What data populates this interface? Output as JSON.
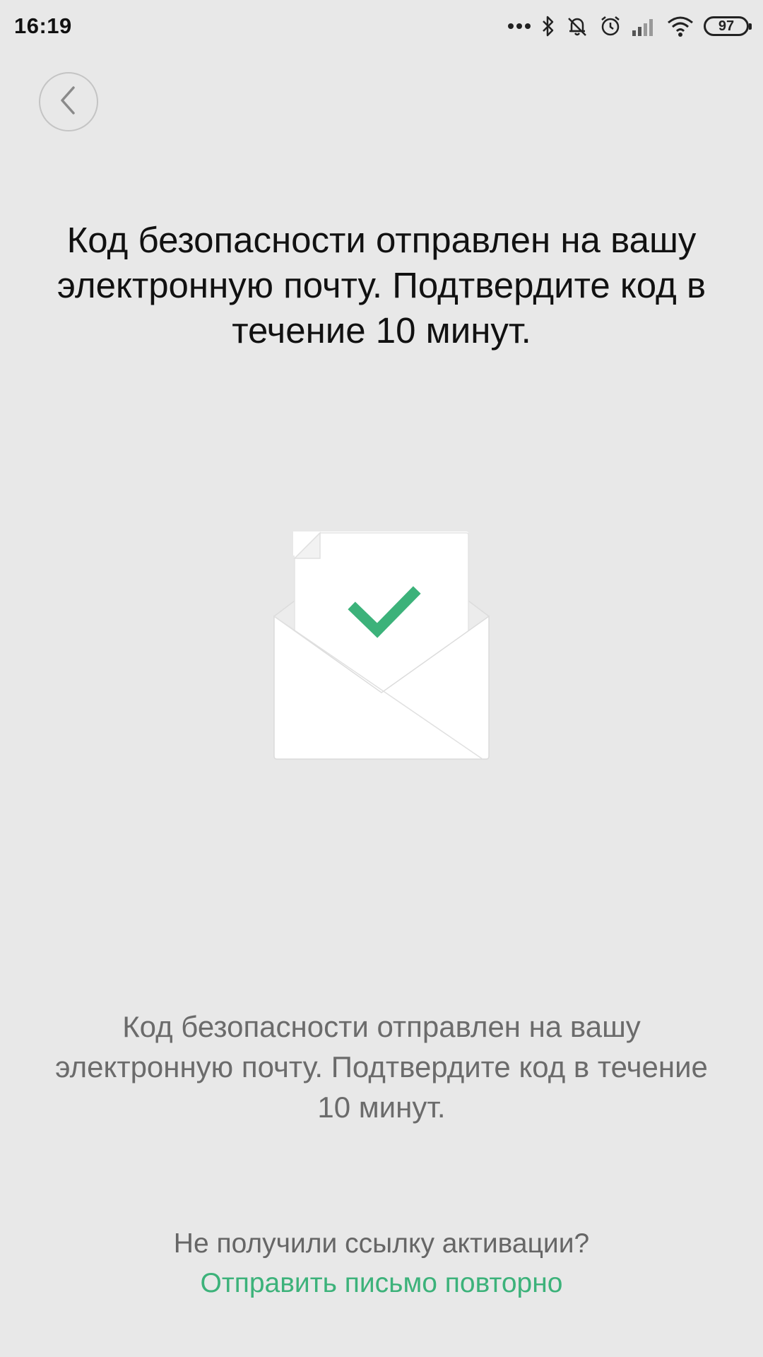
{
  "status_bar": {
    "time": "16:19",
    "battery_level": "97",
    "icons": [
      "more-dots-icon",
      "bluetooth-icon",
      "silent-bell-icon",
      "alarm-icon",
      "signal-icon",
      "wifi-icon",
      "battery-icon"
    ]
  },
  "header": {
    "back_icon": "chevron-left-icon"
  },
  "main": {
    "headline": "Код безопасности отправлен на вашу электронную почту. Подтвердите код в течение 10 минут.",
    "illustration": "envelope-check-icon",
    "body_text": "Код безопасности отправлен на вашу электронную почту. Подтвердите код в течение 10 минут."
  },
  "footer": {
    "question": "Не получили ссылку активации?",
    "resend_link": "Отправить письмо повторно"
  },
  "colors": {
    "background": "#e8e8e8",
    "accent_green": "#3cb27a",
    "headline": "#111111",
    "body": "#6b6b6b"
  }
}
